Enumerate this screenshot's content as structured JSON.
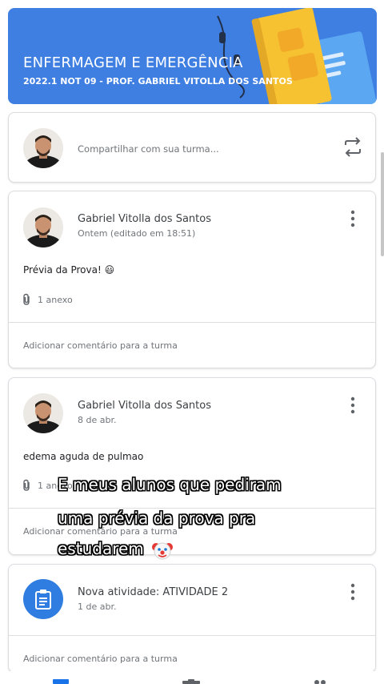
{
  "banner": {
    "title": "ENFERMAGEM E EMERGÊNCIA",
    "subtitle": "2022.1 NOT 09 - PROF. GABRIEL VITOLLA DOS SANTOS"
  },
  "share": {
    "placeholder": "Compartilhar com sua turma...",
    "icon": "repost-icon"
  },
  "posts": [
    {
      "author": "Gabriel Vitolla dos Santos",
      "date": "Ontem (editado em 18:51)",
      "body": "Prévia da Prova! 😃",
      "attachments": "1 anexo",
      "comment_placeholder": "Adicionar comentário para a turma"
    },
    {
      "author": "Gabriel Vitolla dos Santos",
      "date": "8 de abr.",
      "body": "edema aguda de pulmao",
      "attachments": "1 anexo",
      "comment_placeholder": "Adicionar comentário para a turma"
    }
  ],
  "activity": {
    "title": "Nova atividade: ATIVIDADE 2",
    "date": "1 de abr.",
    "comment_placeholder": "Adicionar comentário para a turma",
    "icon": "assignment-icon"
  },
  "caption": {
    "line1": "E meus alunos que pediram",
    "line2": "uma prévia da prova pra",
    "line3": "estudarem"
  },
  "colors": {
    "banner": "#3f7fe2",
    "accent": "#2f7de1",
    "book_yellow": "#f6c231",
    "book_blue": "#5ba7f2"
  }
}
